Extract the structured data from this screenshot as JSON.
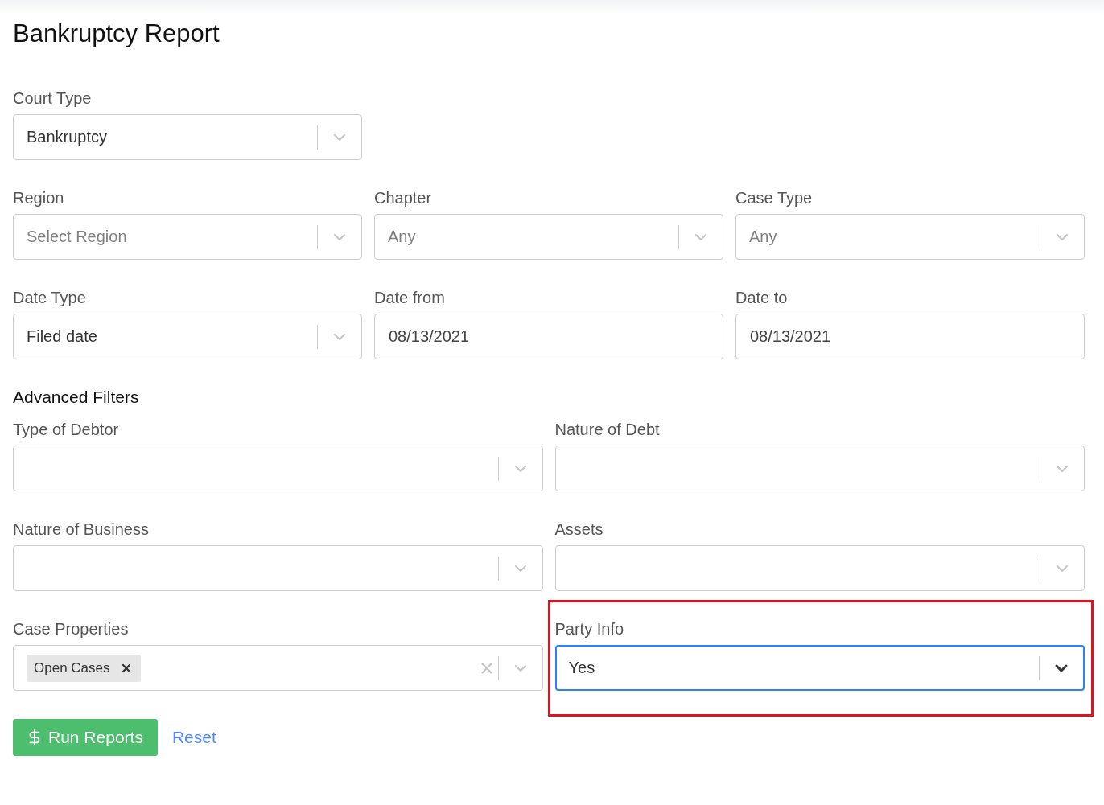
{
  "title": "Bankruptcy Report",
  "sections": [
    {
      "kind": "basic",
      "rows": [
        [
          {
            "label": "Court Type",
            "kind": "select",
            "value": "Bankruptcy"
          }
        ],
        [
          {
            "label": "Region",
            "kind": "select",
            "placeholder": "Select Region"
          },
          {
            "label": "Chapter",
            "kind": "select",
            "placeholder": "Any"
          },
          {
            "label": "Case Type",
            "kind": "select",
            "placeholder": "Any"
          }
        ],
        [
          {
            "label": "Date Type",
            "kind": "select",
            "value": "Filed date"
          },
          {
            "label": "Date from",
            "kind": "date",
            "value": "08/13/2021"
          },
          {
            "label": "Date to",
            "kind": "date",
            "value": "08/13/2021"
          }
        ]
      ]
    },
    {
      "kind": "advanced",
      "heading": "Advanced Filters",
      "rows": [
        [
          {
            "label": "Type of Debtor",
            "kind": "select"
          },
          {
            "label": "Nature of Debt",
            "kind": "select"
          }
        ],
        [
          {
            "label": "Nature of Business",
            "kind": "select"
          },
          {
            "label": "Assets",
            "kind": "select"
          }
        ],
        [
          {
            "label": "Case Properties",
            "kind": "multi_select",
            "tags": [
              "Open Cases"
            ]
          },
          {
            "label": "Party Info",
            "kind": "select",
            "value": "Yes",
            "focused": true,
            "highlighted": true
          }
        ]
      ]
    }
  ],
  "actions": {
    "primary": "Run Reports",
    "secondary": "Reset"
  }
}
